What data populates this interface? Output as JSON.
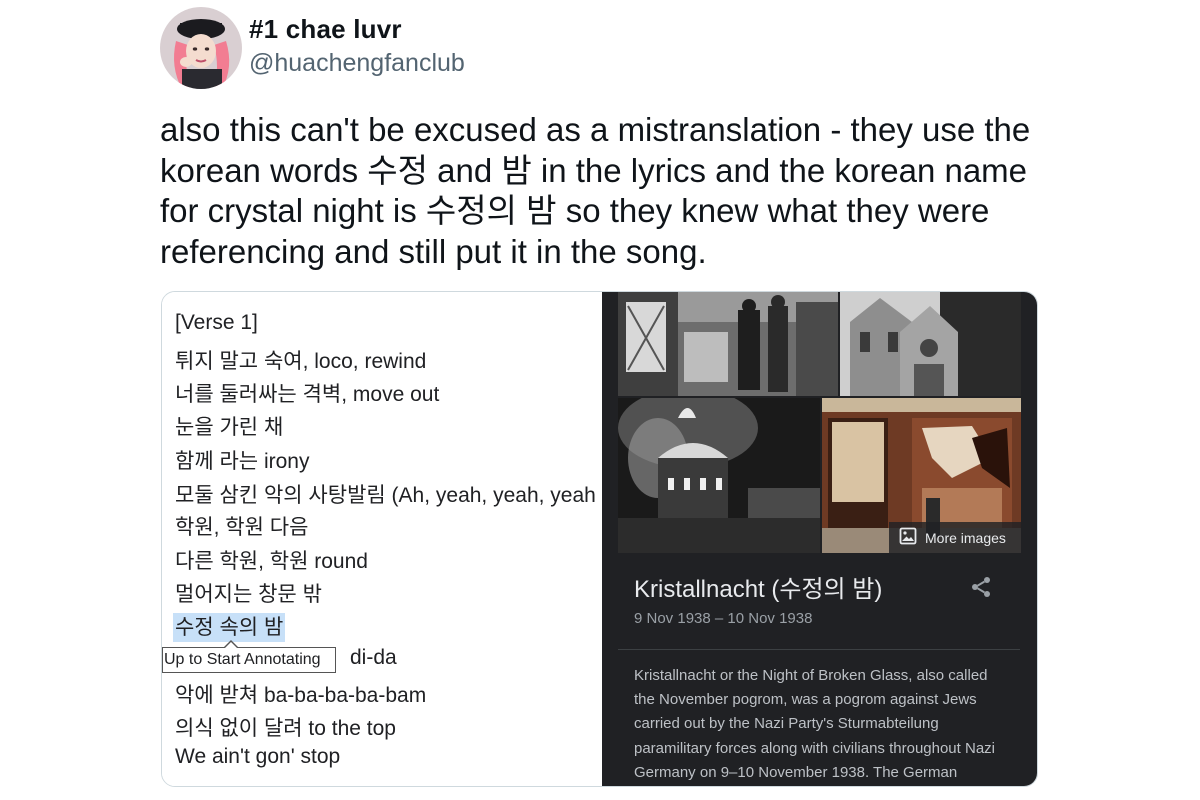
{
  "tweet": {
    "display_name": "#1 chae luvr",
    "handle": "@huachengfanclub",
    "text": "also this can't be excused as a mistranslation - they use the korean words 수정 and 밤 in the lyrics and the korean name for crystal night is 수정의 밤 so they knew what they were referencing and still put it in the song."
  },
  "lyrics": {
    "lines": [
      "[Verse 1]",
      "튀지 말고 숙여, loco, rewind",
      "너를 둘러싸는 격벽, move out",
      "눈을 가린 채",
      "함께 라는 irony",
      "모둘 삼킨 악의 사탕발림 (Ah, yeah, yeah, yeah",
      "학원, 학원 다음",
      "다른 학원, 학원 round",
      "멀어지는 창문 밖",
      "수정 속의 밤",
      "di-da",
      "악에 받쳐 ba-ba-ba-ba-bam",
      "의식 없이 달려 to the top",
      "We ain't gon' stop"
    ],
    "highlighted_line": "수정 속의 밤",
    "tooltip": "Up to Start Annotating"
  },
  "knowledge_panel": {
    "more_images_label": "More images",
    "title": "Kristallnacht (수정의 밤)",
    "dates": "9 Nov 1938 – 10 Nov 1938",
    "description": "Kristallnacht or the Night of Broken Glass, also called the November pogrom, was a pogrom against Jews carried out by the Nazi Party's Sturmabteilung paramilitary forces along with civilians throughout Nazi Germany on 9–10 November 1938. The German",
    "share_icon": "share-icon",
    "image_icon": "image-icon"
  },
  "colors": {
    "highlight": "#c7e0f8",
    "panel_background": "#202124",
    "handle_gray": "#536471"
  }
}
